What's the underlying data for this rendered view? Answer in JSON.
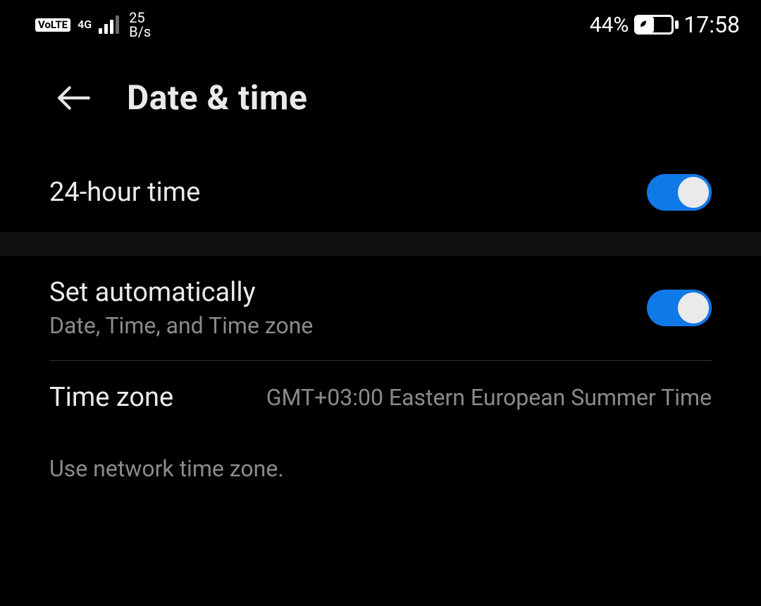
{
  "statusbar": {
    "volte": "VoLTE",
    "net_gen": "4G",
    "speed_value": "25",
    "speed_unit": "B/s",
    "battery_pct": "44%",
    "clock": "17:58"
  },
  "header": {
    "title": "Date & time"
  },
  "rows": {
    "twenty_four_hour": {
      "label": "24-hour time",
      "on": true
    },
    "set_auto": {
      "label": "Set automatically",
      "sub": "Date, Time, and Time zone",
      "on": true
    },
    "timezone": {
      "label": "Time zone",
      "value": "GMT+03:00 Eastern European Summer Time"
    }
  },
  "footer": {
    "note": "Use network time zone."
  },
  "colors": {
    "accent": "#1079e8"
  }
}
